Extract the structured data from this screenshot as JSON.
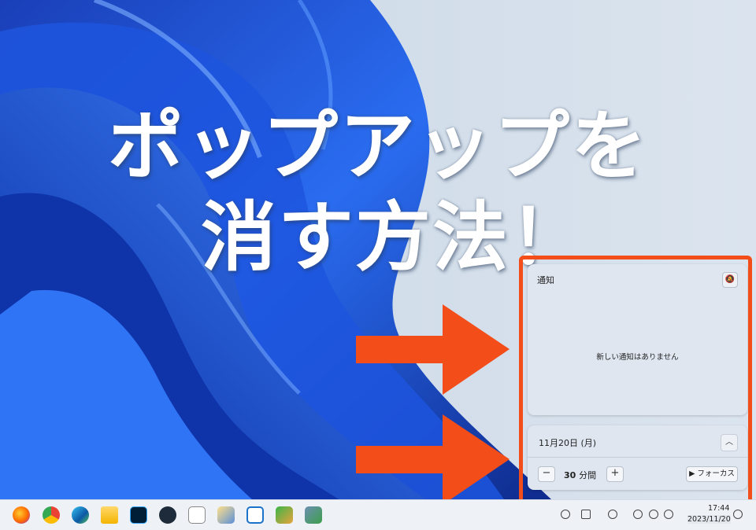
{
  "headline": {
    "line1": "ポップアップを",
    "line2": "消す方法！"
  },
  "notification_panel": {
    "title": "通知",
    "empty_message": "新しい通知はありません",
    "dnd_icon": "bell-slash-icon"
  },
  "calendar_panel": {
    "date_label": "11月20日 (月)",
    "collapse_icon": "chevron-up-icon",
    "focus": {
      "minus_label": "−",
      "minutes": "30",
      "unit": "分間",
      "plus_label": "+",
      "button_label": "▶ フォーカス"
    }
  },
  "taskbar": {
    "apps": [
      "firefox-icon",
      "chrome-icon",
      "edge-icon",
      "file-explorer-icon",
      "photoshop-icon",
      "app-icon",
      "qr-app-icon",
      "paint-icon",
      "bracket-app-icon",
      "green-app-icon",
      "network-app-icon"
    ],
    "time": "17:44",
    "date": "2023/11/20"
  },
  "colors": {
    "highlight": "#f34d1a",
    "accent_arrow": "#f34d1a",
    "wallpaper_blue": "#1f5de0"
  }
}
